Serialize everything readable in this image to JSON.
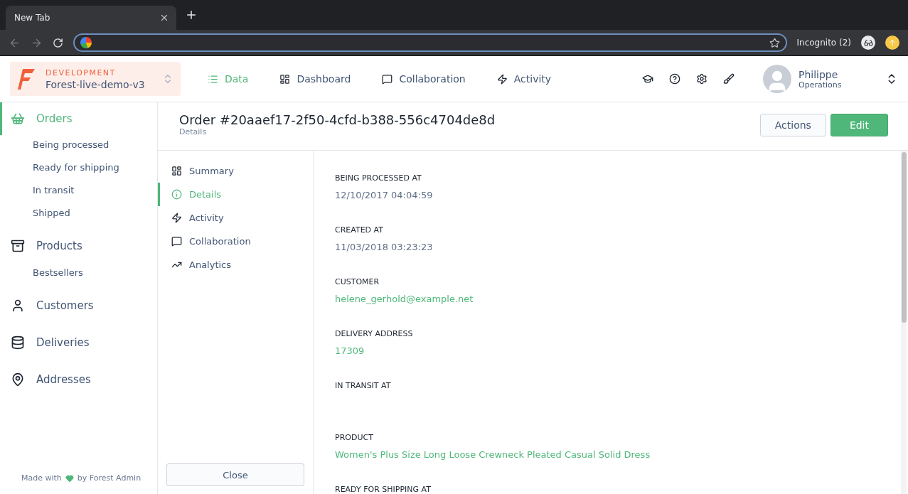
{
  "browser": {
    "tab_title": "New Tab",
    "profile": "Incognito (2)"
  },
  "header": {
    "environment": "DEVELOPMENT",
    "project": "Forest-live-demo-v3",
    "nav": [
      {
        "label": "Data",
        "selected": true
      },
      {
        "label": "Dashboard",
        "selected": false
      },
      {
        "label": "Collaboration",
        "selected": false
      },
      {
        "label": "Activity",
        "selected": false
      }
    ],
    "user": {
      "name": "Philippe",
      "team": "Operations"
    }
  },
  "sidebar": {
    "items": [
      {
        "label": "Orders",
        "selected": true,
        "children": [
          {
            "label": "Being processed",
            "selected": false
          },
          {
            "label": "Ready for shipping",
            "selected": false
          },
          {
            "label": "In transit",
            "selected": false
          },
          {
            "label": "Shipped",
            "selected": false
          }
        ]
      },
      {
        "label": "Products",
        "selected": false,
        "children": [
          {
            "label": "Bestsellers",
            "selected": false
          }
        ]
      },
      {
        "label": "Customers",
        "selected": false
      },
      {
        "label": "Deliveries",
        "selected": false
      },
      {
        "label": "Addresses",
        "selected": false
      }
    ],
    "footer_before": "Made with",
    "footer_after": "by Forest Admin"
  },
  "record": {
    "title": "Order #20aaef17-2f50-4cfd-b388-556c4704de8d",
    "subtitle": "Details",
    "buttons": [
      "Actions",
      "Edit"
    ],
    "tabs": [
      {
        "label": "Summary",
        "selected": false
      },
      {
        "label": "Details",
        "selected": true
      },
      {
        "label": "Activity",
        "selected": false
      },
      {
        "label": "Collaboration",
        "selected": false
      },
      {
        "label": "Analytics",
        "selected": false
      }
    ],
    "close_button": "Close",
    "fields": [
      {
        "label": "BEING PROCESSED AT",
        "value": "12/10/2017 04:04:59",
        "kind": "text"
      },
      {
        "label": "CREATED AT",
        "value": "11/03/2018 03:23:23",
        "kind": "text"
      },
      {
        "label": "CUSTOMER",
        "value": "helene_gerhold@example.net",
        "kind": "link"
      },
      {
        "label": "DELIVERY ADDRESS",
        "value": "17309",
        "kind": "link"
      },
      {
        "label": "IN TRANSIT AT",
        "kind": "empty"
      },
      {
        "label": "PRODUCT",
        "value": "Women's Plus Size Long Loose Crewneck Pleated Casual Solid Dress",
        "kind": "link"
      },
      {
        "label": "READY FOR SHIPPING AT",
        "kind": "empty"
      }
    ]
  }
}
